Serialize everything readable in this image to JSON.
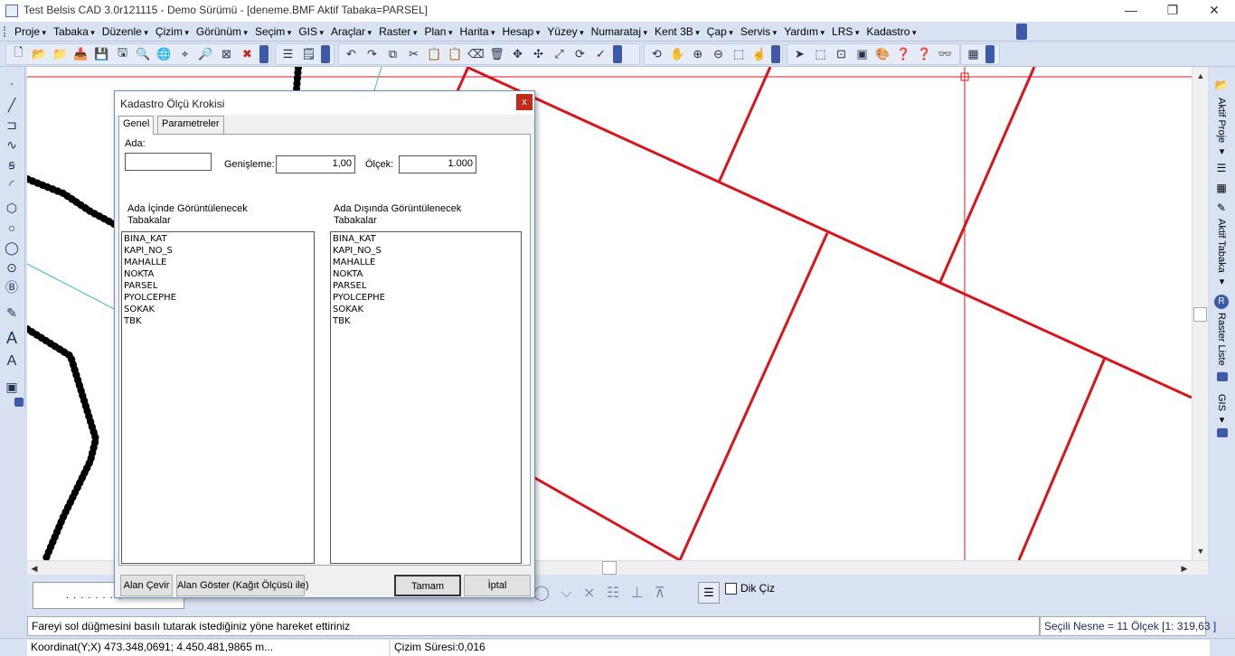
{
  "window": {
    "title": "Test Belsis CAD 3.0r121115 - Demo Sürümü - [deneme.BMF  Aktif Tabaka=PARSEL]",
    "minimize": "—",
    "restore": "❐",
    "close": "✕"
  },
  "menus": [
    "Proje",
    "Tabaka",
    "Düzenle",
    "Çizim",
    "Görünüm",
    "Seçim",
    "GIS",
    "Araçlar",
    "Raster",
    "Plan",
    "Harita",
    "Hesap",
    "Yüzey",
    "Numarataj",
    "Kent 3B",
    "Çap",
    "Servis",
    "Yardım",
    "LRS",
    "Kadastro"
  ],
  "toolbar_icons": {
    "file": [
      "new-icon",
      "open-icon",
      "open-folder-icon",
      "import-icon",
      "save-icon",
      "save-as-icon",
      "print-preview-icon",
      "google-icon",
      "target-icon",
      "zoom-doc-icon",
      "cancel-box-icon",
      "close-red-icon"
    ],
    "layers": [
      "layers-icon",
      "properties-icon"
    ],
    "edit": [
      "undo-icon",
      "redo-icon",
      "copy-icon",
      "cut-icon",
      "paste-icon",
      "paste-special-icon",
      "erase-icon",
      "delete-icon",
      "move-icon",
      "move-cross-icon",
      "scale-icon",
      "rotate-icon",
      "trim-icon"
    ],
    "view": [
      "refresh-icon",
      "pan-icon",
      "zoom-in-icon",
      "zoom-out-icon",
      "zoom-window-icon",
      "zoom-pan-icon"
    ],
    "select": [
      "select-arrow-icon",
      "select-window-icon",
      "select-cross-icon",
      "select-group-icon",
      "select-color-icon",
      "help-icon",
      "help-red-icon",
      "binoculars-icon"
    ],
    "misc": [
      "grid-icon"
    ]
  },
  "left_tools": [
    "point-icon",
    "line-icon",
    "polyline-icon",
    "spline-icon",
    "curve-icon",
    "arc-icon",
    "polygon-icon",
    "circle-icon",
    "circle-2-icon",
    "circle-center-icon",
    "circle-text-icon",
    "measure-icon",
    "text-bold-icon",
    "text-icon",
    "image-icon"
  ],
  "right_panel": {
    "aktif_proje": "Aktif Proje ▾",
    "aktif_tabaka": "Aktif Tabaka ▾",
    "raster_liste": "Raster Liste ▾",
    "gis": "GIS ▾"
  },
  "dialog": {
    "title": "Kadastro Ölçü Krokisi",
    "close": "x",
    "tabs": [
      "Genel",
      "Parametreler"
    ],
    "ada_label": "Ada:",
    "ada_value": "",
    "genisleme_label": "Genişleme:",
    "genisleme_value": "1,00",
    "olcek_label": "Ölçek:",
    "olcek_value": "1.000",
    "inside_label_1": "Ada İçinde Görüntülenecek",
    "inside_label_2": "Tabakalar",
    "outside_label_1": "Ada Dışında Görüntülenecek",
    "outside_label_2": "Tabakalar",
    "inside_layers": [
      "BINA_KAT",
      "KAPI_NO_S",
      "MAHALLE",
      "NOKTA",
      "PARSEL",
      "PYOLCEPHE",
      "SOKAK",
      "TBK"
    ],
    "outside_layers": [
      "BINA_KAT",
      "KAPI_NO_S",
      "MAHALLE",
      "NOKTA",
      "PARSEL",
      "PYOLCEPHE",
      "SOKAK",
      "TBK"
    ],
    "buttons": {
      "alan_cevir": "Alan Çevir",
      "alan_goster": "Alan Göster (Kağıt Ölçüsü ile)",
      "tamam": "Tamam",
      "iptal": "İptal"
    }
  },
  "command": {
    "dots": ". . . . . . . $",
    "dik_ciz": "Dik Çiz"
  },
  "status": {
    "hint": "Fareyi sol düğmesini basılı tutarak istediğiniz yöne hareket ettiriniz",
    "selection": "Seçili Nesne = 11  Ölçek [1: 319,63 ]",
    "coordinate": "Koordinat(Y;X)  473.348,0691; 4.450.481,9865 m...",
    "draw_time": "Çizim Süresi:0,016"
  },
  "colors": {
    "parcel_line": "#d9141b",
    "road_line": "#000000",
    "cyan_line": "#3fb6d8",
    "accent": "#3c5aa8"
  }
}
